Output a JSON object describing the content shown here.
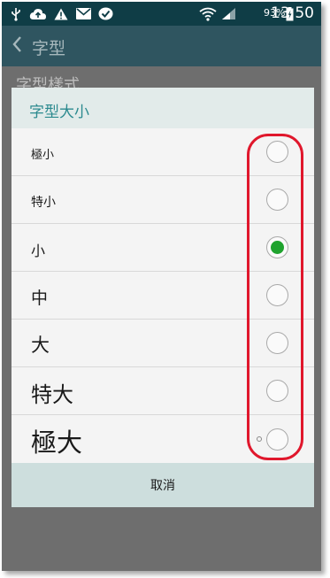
{
  "status_bar": {
    "icons": [
      "usb-icon",
      "cloud-upload-icon",
      "warning-icon",
      "mail-icon",
      "check-badge-icon",
      "wifi-icon",
      "signal-icon",
      "battery-icon"
    ],
    "battery_percent": "93%",
    "time": "13:50"
  },
  "app_bar": {
    "title": "字型"
  },
  "background_screen": {
    "item_label": "字型樣式"
  },
  "dialog": {
    "title": "字型大小",
    "options": [
      {
        "label": "極小",
        "selected": false
      },
      {
        "label": "特小",
        "selected": false
      },
      {
        "label": "小",
        "selected": true
      },
      {
        "label": "中",
        "selected": false
      },
      {
        "label": "大",
        "selected": false
      },
      {
        "label": "特大",
        "selected": false
      },
      {
        "label": "極大",
        "selected": false
      }
    ],
    "cancel_label": "取消"
  },
  "colors": {
    "status_bar": "#0f3d46",
    "app_bar": "#2f5560",
    "dialog_title": "#2c8a8f",
    "radio_selected": "#1fa32e",
    "annotation_outline": "#e0172c"
  }
}
